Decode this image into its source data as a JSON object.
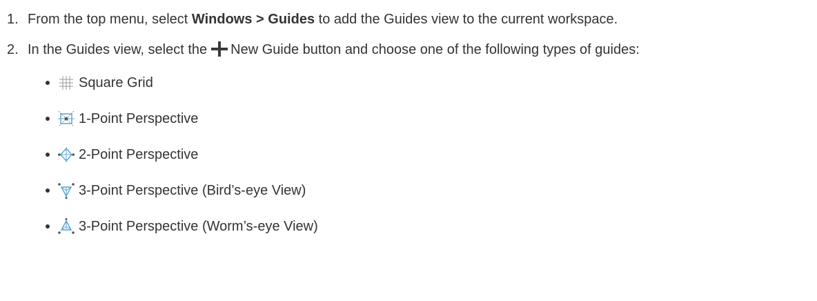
{
  "steps": [
    {
      "number": "1.",
      "text_before": "From the top menu, select ",
      "bold_menu": "Windows > Guides",
      "text_after": " to add the Guides view to the current workspace."
    },
    {
      "number": "2.",
      "text_before": "In the Guides view, select the",
      "button_label": "New Guide",
      "text_after": " button and choose one of the following types of guides:"
    }
  ],
  "guide_types": [
    {
      "icon": "square-grid-icon",
      "label": "Square Grid"
    },
    {
      "icon": "one-point-perspective-icon",
      "label": "1-Point Perspective"
    },
    {
      "icon": "two-point-perspective-icon",
      "label": "2-Point Perspective"
    },
    {
      "icon": "three-point-birds-eye-icon",
      "label": "3-Point Perspective (Bird’s-eye View)"
    },
    {
      "icon": "three-point-worms-eye-icon",
      "label": "3-Point Perspective (Worm’s-eye View)"
    }
  ],
  "colors": {
    "text": "#333333",
    "plus_icon": "#3a3a3a",
    "guide_icon_blue": "#5aa7d8",
    "guide_icon_dark": "#555555"
  }
}
